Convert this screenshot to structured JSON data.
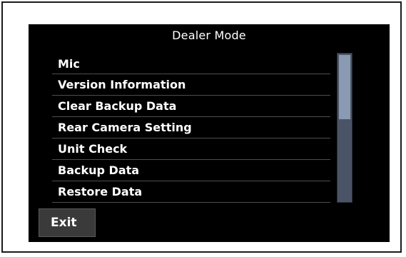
{
  "screen": {
    "title": "Dealer Mode"
  },
  "menu": {
    "items": [
      {
        "label": "Mic"
      },
      {
        "label": "Version Information"
      },
      {
        "label": "Clear Backup Data"
      },
      {
        "label": "Rear Camera Setting"
      },
      {
        "label": "Unit Check"
      },
      {
        "label": "Backup Data"
      },
      {
        "label": "Restore Data"
      }
    ]
  },
  "footer": {
    "exit_label": "Exit"
  },
  "colors": {
    "screen_background": "#000000",
    "text": "#ffffff",
    "scrollbar_track": "#4a5466",
    "scrollbar_thumb": "#8a9ab2",
    "button": "#3a3a3a"
  }
}
